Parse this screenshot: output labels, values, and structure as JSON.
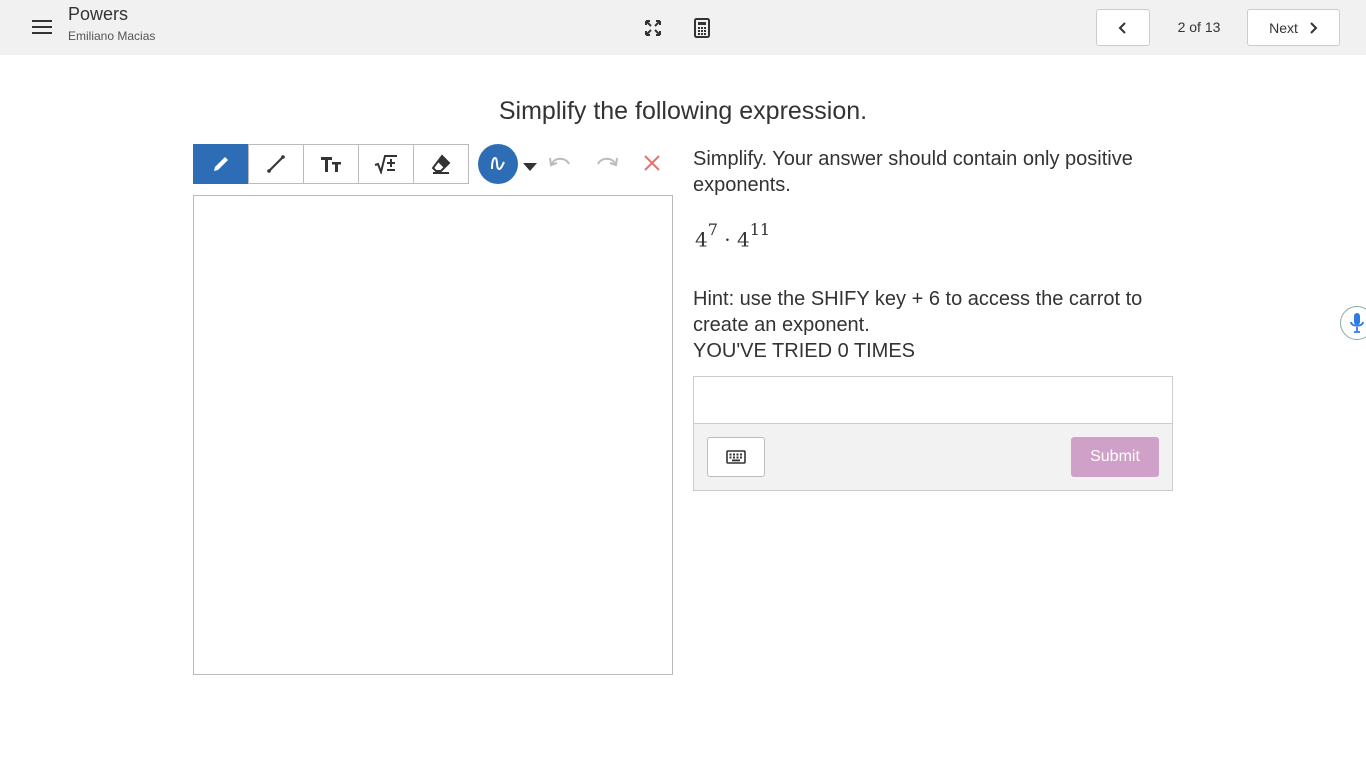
{
  "header": {
    "title": "Powers",
    "subtitle": "Emiliano Macias",
    "page_indicator": "2 of 13",
    "next_label": "Next",
    "icons": {
      "menu": "menu-icon",
      "fullscreen": "fullscreen-icon",
      "calculator": "calculator-icon",
      "prev": "chevron-left-icon",
      "next": "chevron-right-icon"
    }
  },
  "main": {
    "heading": "Simplify the following expression."
  },
  "toolbar": {
    "tools": [
      "pencil-icon",
      "line-icon",
      "text-icon",
      "math-icon",
      "eraser-icon"
    ],
    "active_tool": "pencil-icon",
    "extra": [
      "pen-style-icon",
      "caret-down-icon",
      "undo-icon",
      "redo-icon",
      "clear-icon"
    ],
    "accent_color": "#2d6db5",
    "clear_color": "#e8726b"
  },
  "question": {
    "prompt": "Simplify. Your answer should contain only positive exponents.",
    "expression": {
      "base1": "4",
      "exp1": "7",
      "operator": "·",
      "base2": "4",
      "exp2": "11"
    },
    "hint": "Hint: use the SHIFY key + 6 to access the carrot to create an exponent.",
    "tries": "YOU'VE TRIED 0 TIMES"
  },
  "answer": {
    "value": "",
    "placeholder": "",
    "submit_label": "Submit",
    "submit_color": "#cfa0c8",
    "keyboard_icon": "keyboard-icon"
  },
  "side_widget": {
    "icon": "microphone-icon"
  }
}
